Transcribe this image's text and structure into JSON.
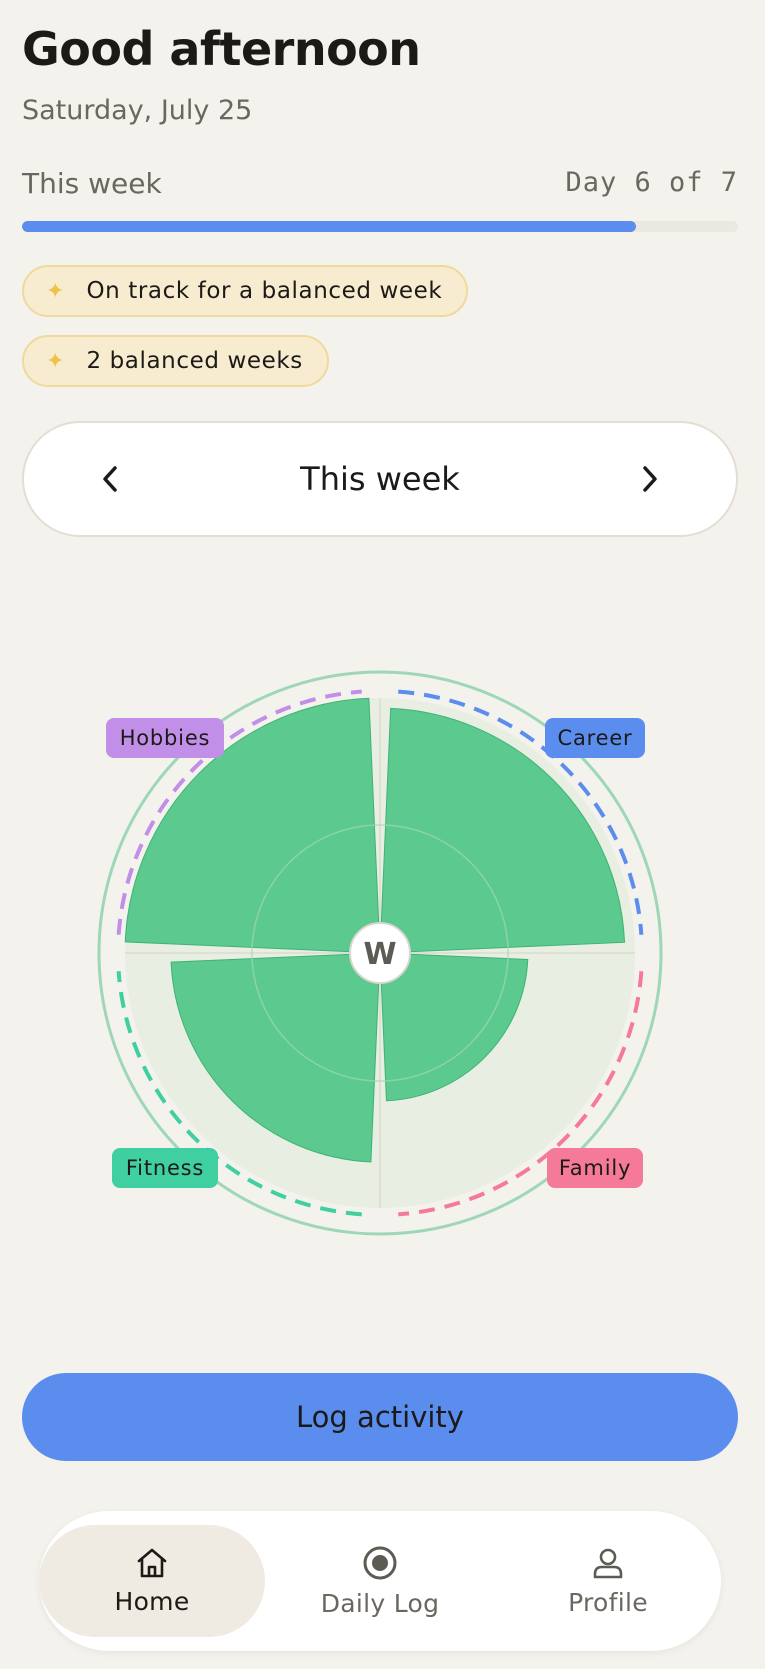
{
  "header": {
    "greeting": "Good afternoon",
    "date": "Saturday, July 25"
  },
  "progress": {
    "label": "This week",
    "day_text": "Day 6 of 7",
    "fraction": 0.857,
    "color": "#5b8def"
  },
  "badges": [
    {
      "icon": "sparkle-icon",
      "text": "On track for a balanced week"
    },
    {
      "icon": "sparkle-icon",
      "text": "2 balanced weeks"
    }
  ],
  "week_nav": {
    "title": "This week",
    "prev_icon": "chevron-left-icon",
    "next_icon": "chevron-right-icon"
  },
  "wheel": {
    "center_label": "W",
    "fill_color": "#4fc688",
    "categories": [
      {
        "name": "Career",
        "color": "#5b8def",
        "fill": 0.96
      },
      {
        "name": "Family",
        "color": "#f57a9a",
        "fill": 0.58
      },
      {
        "name": "Fitness",
        "color": "#3fcfa0",
        "fill": 0.82
      },
      {
        "name": "Hobbies",
        "color": "#c18ee8",
        "fill": 1.0
      }
    ]
  },
  "actions": {
    "log_label": "Log activity"
  },
  "tabbar": {
    "tabs": [
      {
        "label": "Home",
        "icon": "home-icon",
        "active": true
      },
      {
        "label": "Daily Log",
        "icon": "record-icon",
        "active": false
      },
      {
        "label": "Profile",
        "icon": "user-icon",
        "active": false
      }
    ]
  }
}
